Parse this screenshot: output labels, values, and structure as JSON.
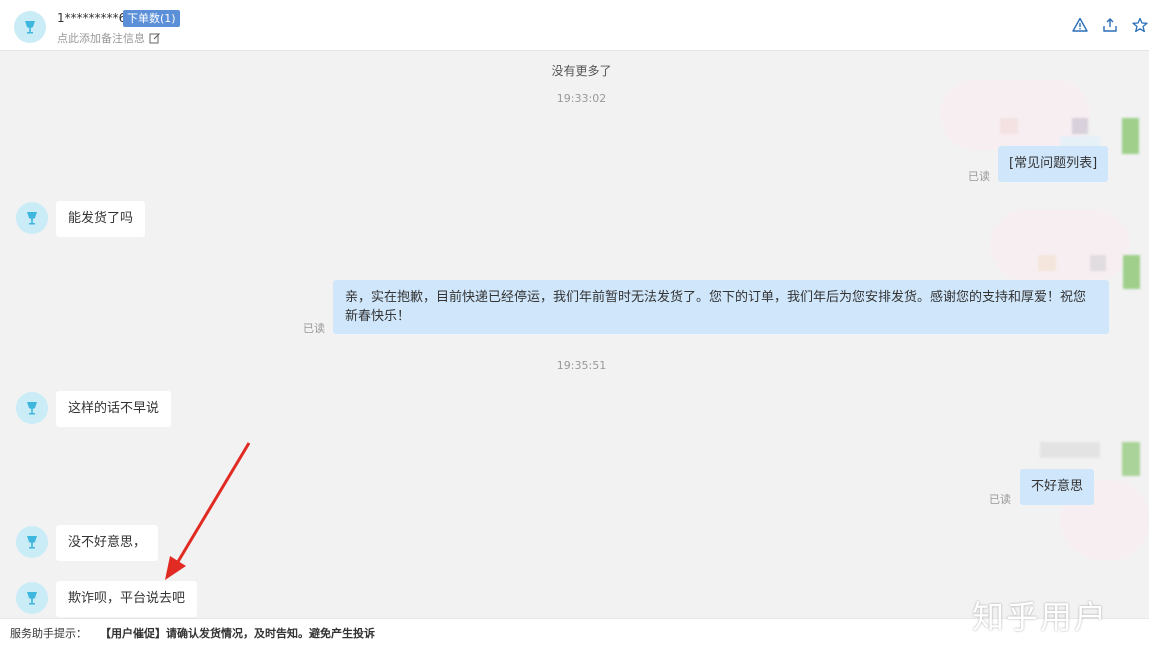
{
  "header": {
    "name": "1*********6",
    "order_badge": "下单数(1)",
    "note_hint": "点此添加备注信息",
    "icons": [
      "alert-icon",
      "share-icon",
      "star-icon"
    ]
  },
  "chat": {
    "no_more": "没有更多了",
    "timestamps": [
      "19:33:02",
      "19:35:51"
    ],
    "messages": [
      {
        "side": "right",
        "text": "[常见问题列表]",
        "status": "已读"
      },
      {
        "side": "left",
        "text": "能发货了吗"
      },
      {
        "side": "right",
        "text": "亲，实在抱歉，目前快递已经停运，我们年前暂时无法发货了。您下的订单，我们年后为您安排发货。感谢您的支持和厚爱！祝您新春快乐！",
        "status": "已读"
      },
      {
        "side": "left",
        "text": "这样的话不早说"
      },
      {
        "side": "right",
        "text": "不好意思",
        "status": "已读"
      },
      {
        "side": "left",
        "text": "没不好意思，"
      },
      {
        "side": "left",
        "text": "欺诈呗，平台说去吧"
      }
    ]
  },
  "footer": {
    "label": "服务助手提示：",
    "text": "【用户催促】请确认发货情况，及时告知。避免产生投诉"
  },
  "watermark": "知乎用户",
  "colors": {
    "accent_badge": "#5b8fd8",
    "bubble_right": "#cfe6fb",
    "bubble_left": "#ffffff",
    "arrow": "#e02a22",
    "avatar_bg": "#c9ecf7"
  }
}
